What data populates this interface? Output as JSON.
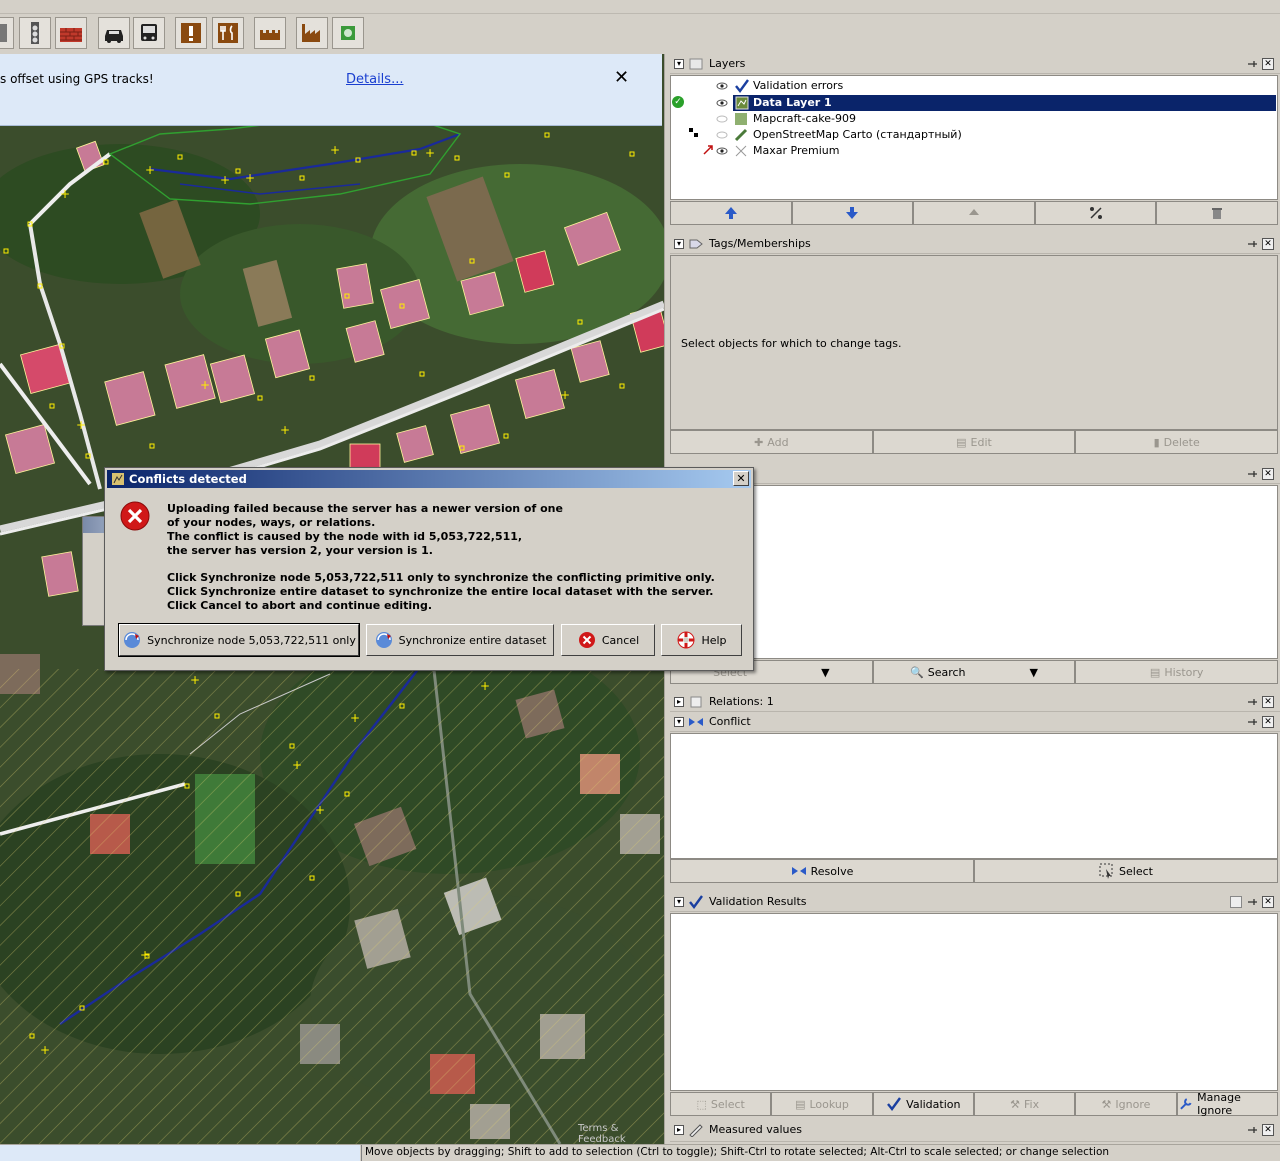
{
  "toolbar": {
    "buttons": [
      {
        "name": "tool-icon-1"
      },
      {
        "name": "traffic-light-icon"
      },
      {
        "name": "wall-icon"
      },
      {
        "name": "car-icon"
      },
      {
        "name": "bus-icon"
      },
      {
        "name": "exclamation-icon"
      },
      {
        "name": "restaurant-icon"
      },
      {
        "name": "castle-icon"
      },
      {
        "name": "factory-icon"
      },
      {
        "name": "plugin-icon"
      }
    ]
  },
  "notification": {
    "message": "s offset using GPS tracks!",
    "link": "Details..."
  },
  "map": {
    "attribution": "Terms & Feedback"
  },
  "layers_panel": {
    "title": "Layers",
    "layers": [
      {
        "name": "Validation errors",
        "visible": true,
        "selected": false
      },
      {
        "name": "Data Layer 1",
        "visible": true,
        "selected": true,
        "active": true
      },
      {
        "name": "Mapcraft-cake-909",
        "visible": false,
        "selected": false
      },
      {
        "name": "OpenStreetMap Carto (стандартный)",
        "visible": false,
        "selected": false
      },
      {
        "name": "Maxar Premium",
        "visible": true,
        "selected": false
      }
    ]
  },
  "tags_panel": {
    "title": "Tags/Memberships",
    "empty_message": "Select objects for which to change tags.",
    "buttons": {
      "add": "Add",
      "edit": "Edit",
      "delete": "Delete"
    }
  },
  "selection_panel": {
    "buttons": {
      "select": "Select",
      "search": "Search",
      "history": "History"
    }
  },
  "relations_panel": {
    "title": "Relations: 1"
  },
  "conflict_panel": {
    "title": "Conflict",
    "buttons": {
      "resolve": "Resolve",
      "select": "Select"
    }
  },
  "validation_panel": {
    "title": "Validation Results",
    "buttons": {
      "select": "Select",
      "lookup": "Lookup",
      "validation": "Validation",
      "fix": "Fix",
      "ignore": "Ignore",
      "manage_ignore": "Manage Ignore"
    }
  },
  "measured_panel": {
    "title": "Measured values"
  },
  "status_bar": {
    "text": "Move objects by dragging; Shift to add to selection (Ctrl to toggle); Shift-Ctrl to rotate selected; Alt-Ctrl to scale selected; or change selection"
  },
  "dialog": {
    "title": "Conflicts detected",
    "lines": [
      "Uploading failed because the server has a newer version of one",
      "of your nodes, ways, or relations.",
      "The conflict is caused by the node with id 5,053,722,511,",
      "the server has version 2, your version is 1."
    ],
    "lines2": [
      "Click Synchronize node 5,053,722,511 only to synchronize the conflicting primitive only.",
      "Click Synchronize entire dataset to synchronize the entire local dataset with the server.",
      "Click Cancel to abort and continue editing."
    ],
    "buttons": {
      "sync_node": "Synchronize node 5,053,722,511 only",
      "sync_all": "Synchronize entire dataset",
      "cancel": "Cancel",
      "help": "Help"
    }
  },
  "colors": {
    "selection": "#0a246a",
    "dialog_title_start": "#0a246a",
    "dialog_title_end": "#a6caf0",
    "notification_bg": "#dde9f8",
    "error_red": "#d01818"
  }
}
